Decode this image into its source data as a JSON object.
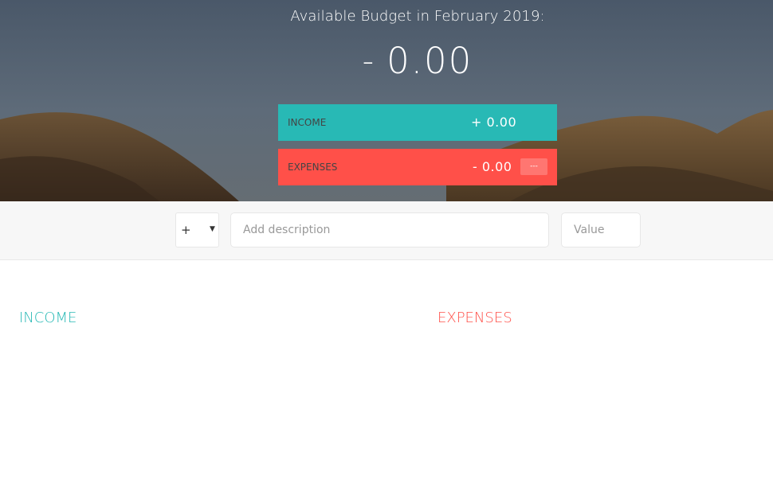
{
  "budget": {
    "title": "Available Budget in February 2019:",
    "sign": "-",
    "value": "0.00"
  },
  "income_summary": {
    "label": "INCOME",
    "value": "+ 0.00",
    "color": "#28b9b5"
  },
  "expenses_summary": {
    "label": "EXPENSES",
    "value": "- 0.00",
    "percentage": "---",
    "color": "#ff5049"
  },
  "add_form": {
    "type_selected": "+",
    "description_placeholder": "Add description",
    "value_placeholder": "Value"
  },
  "lists": {
    "income_title": "INCOME",
    "expenses_title": "EXPENSES"
  }
}
